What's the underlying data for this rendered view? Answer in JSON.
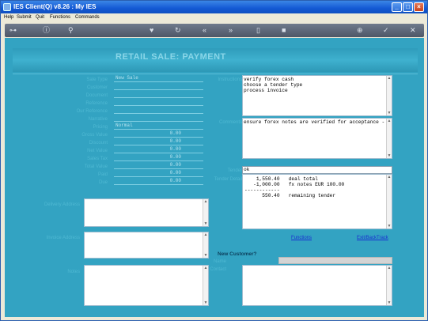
{
  "window": {
    "title": "IES Client(Q) v8.26 : My IES",
    "minimize": "_",
    "maximize": "□",
    "close": "×"
  },
  "menu": [
    "Help",
    "Submit",
    "Quit",
    "Functions",
    "Commands"
  ],
  "toolbar": {
    "icons": [
      "key-icon",
      "info-icon",
      "search-icon",
      "heart-icon",
      "refresh-icon",
      "back-icon",
      "forward-icon",
      "document-icon",
      "stop-icon",
      "add-icon",
      "check-icon",
      "close-icon"
    ],
    "glyphs": [
      "⊶",
      "ⓘ",
      "⚲",
      "♥",
      "↻",
      "«",
      "»",
      "▯",
      "■",
      "⊕",
      "✓",
      "✕"
    ]
  },
  "page": {
    "title": "RETAIL SALE: PAYMENT"
  },
  "form": {
    "rows": [
      {
        "label": "Sale Type",
        "value": "New Sale"
      },
      {
        "label": "Customer",
        "value": ""
      },
      {
        "label": "Document",
        "value": ""
      },
      {
        "label": "Reference",
        "value": ""
      },
      {
        "label": "Our Reference",
        "value": ""
      },
      {
        "label": "Narrative",
        "value": ""
      },
      {
        "label": "Pricing",
        "value": "Normal"
      },
      {
        "label": "Gross Value",
        "value": "0.00"
      },
      {
        "label": "Discount",
        "value": "0.00"
      },
      {
        "label": "Net Value",
        "value": "0.00"
      },
      {
        "label": "Sales Tax",
        "value": "0.00"
      },
      {
        "label": "Total Value",
        "value": "0.00"
      },
      {
        "label": "Paid",
        "value": "0.00"
      },
      {
        "label": "Due",
        "value": "0.00"
      }
    ],
    "lower_labels": [
      "Delivery Address",
      "Invoice Address",
      "Notes"
    ]
  },
  "right": {
    "instructions_label": "Instructions",
    "instructions": "verify forex cash\nchoose a tender type\nprocess invoice",
    "notes_label": "Comments",
    "notes": "ensure forex notes are verified for acceptance -",
    "tender_label": "Tender",
    "tender_input": "ok",
    "tender_detail_label": "Tender Detail",
    "tender_lines": "    1,550.40   deal total\n   -1,000.00   fx notes EUR 100.00\n------------\n      550.40   remaining tender",
    "functions_link": "Functions",
    "exit_link": "Exit/BackTrack",
    "new_customer_title": "New Customer?",
    "customer_label": "Name",
    "contact_label": "Contact"
  }
}
